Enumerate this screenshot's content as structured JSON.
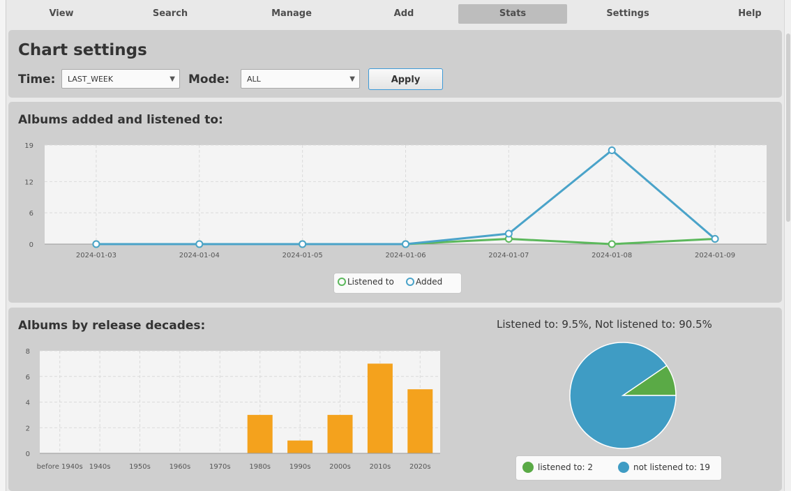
{
  "tabs": [
    {
      "label": "View"
    },
    {
      "label": "Search"
    },
    {
      "label": "Manage"
    },
    {
      "label": "Add"
    },
    {
      "label": "Stats",
      "active": true
    },
    {
      "label": "Settings"
    },
    {
      "label": "Help"
    }
  ],
  "settings": {
    "title": "Chart settings",
    "time_label": "Time:",
    "time_value": "LAST_WEEK",
    "mode_label": "Mode:",
    "mode_value": "ALL",
    "apply_label": "Apply"
  },
  "colors": {
    "listened": "#5cb85c",
    "added": "#4aa3c9",
    "bars": "#f4a21d",
    "pie_listened": "#5aaa46",
    "pie_not_listened": "#3f9cc4"
  },
  "chart_data": [
    {
      "type": "line",
      "title": "Albums added and listened to:",
      "x": [
        "2024-01-03",
        "2024-01-04",
        "2024-01-05",
        "2024-01-06",
        "2024-01-07",
        "2024-01-08",
        "2024-01-09"
      ],
      "series": [
        {
          "name": "Listened to",
          "values": [
            0,
            0,
            0,
            0,
            1,
            0,
            1
          ]
        },
        {
          "name": "Added",
          "values": [
            0,
            0,
            0,
            0,
            2,
            18,
            1
          ]
        }
      ],
      "yticks": [
        0,
        6,
        12,
        19
      ],
      "ylim": [
        0,
        19
      ],
      "grid": true,
      "legend": "bottom-center"
    },
    {
      "type": "bar",
      "title": "Albums by release decades:",
      "categories": [
        "before 1940s",
        "1940s",
        "1950s",
        "1960s",
        "1970s",
        "1980s",
        "1990s",
        "2000s",
        "2010s",
        "2020s"
      ],
      "values": [
        0,
        0,
        0,
        0,
        0,
        3,
        1,
        3,
        7,
        5
      ],
      "yticks": [
        0,
        2,
        4,
        6,
        8
      ],
      "ylim": [
        0,
        8
      ],
      "grid": true
    },
    {
      "type": "pie",
      "title": "Listened to: 9.5%, Not listened to: 90.5%",
      "labels": [
        "listened to: 2",
        "not listened to: 19"
      ],
      "values": [
        2,
        19
      ],
      "legend": "bottom"
    }
  ]
}
